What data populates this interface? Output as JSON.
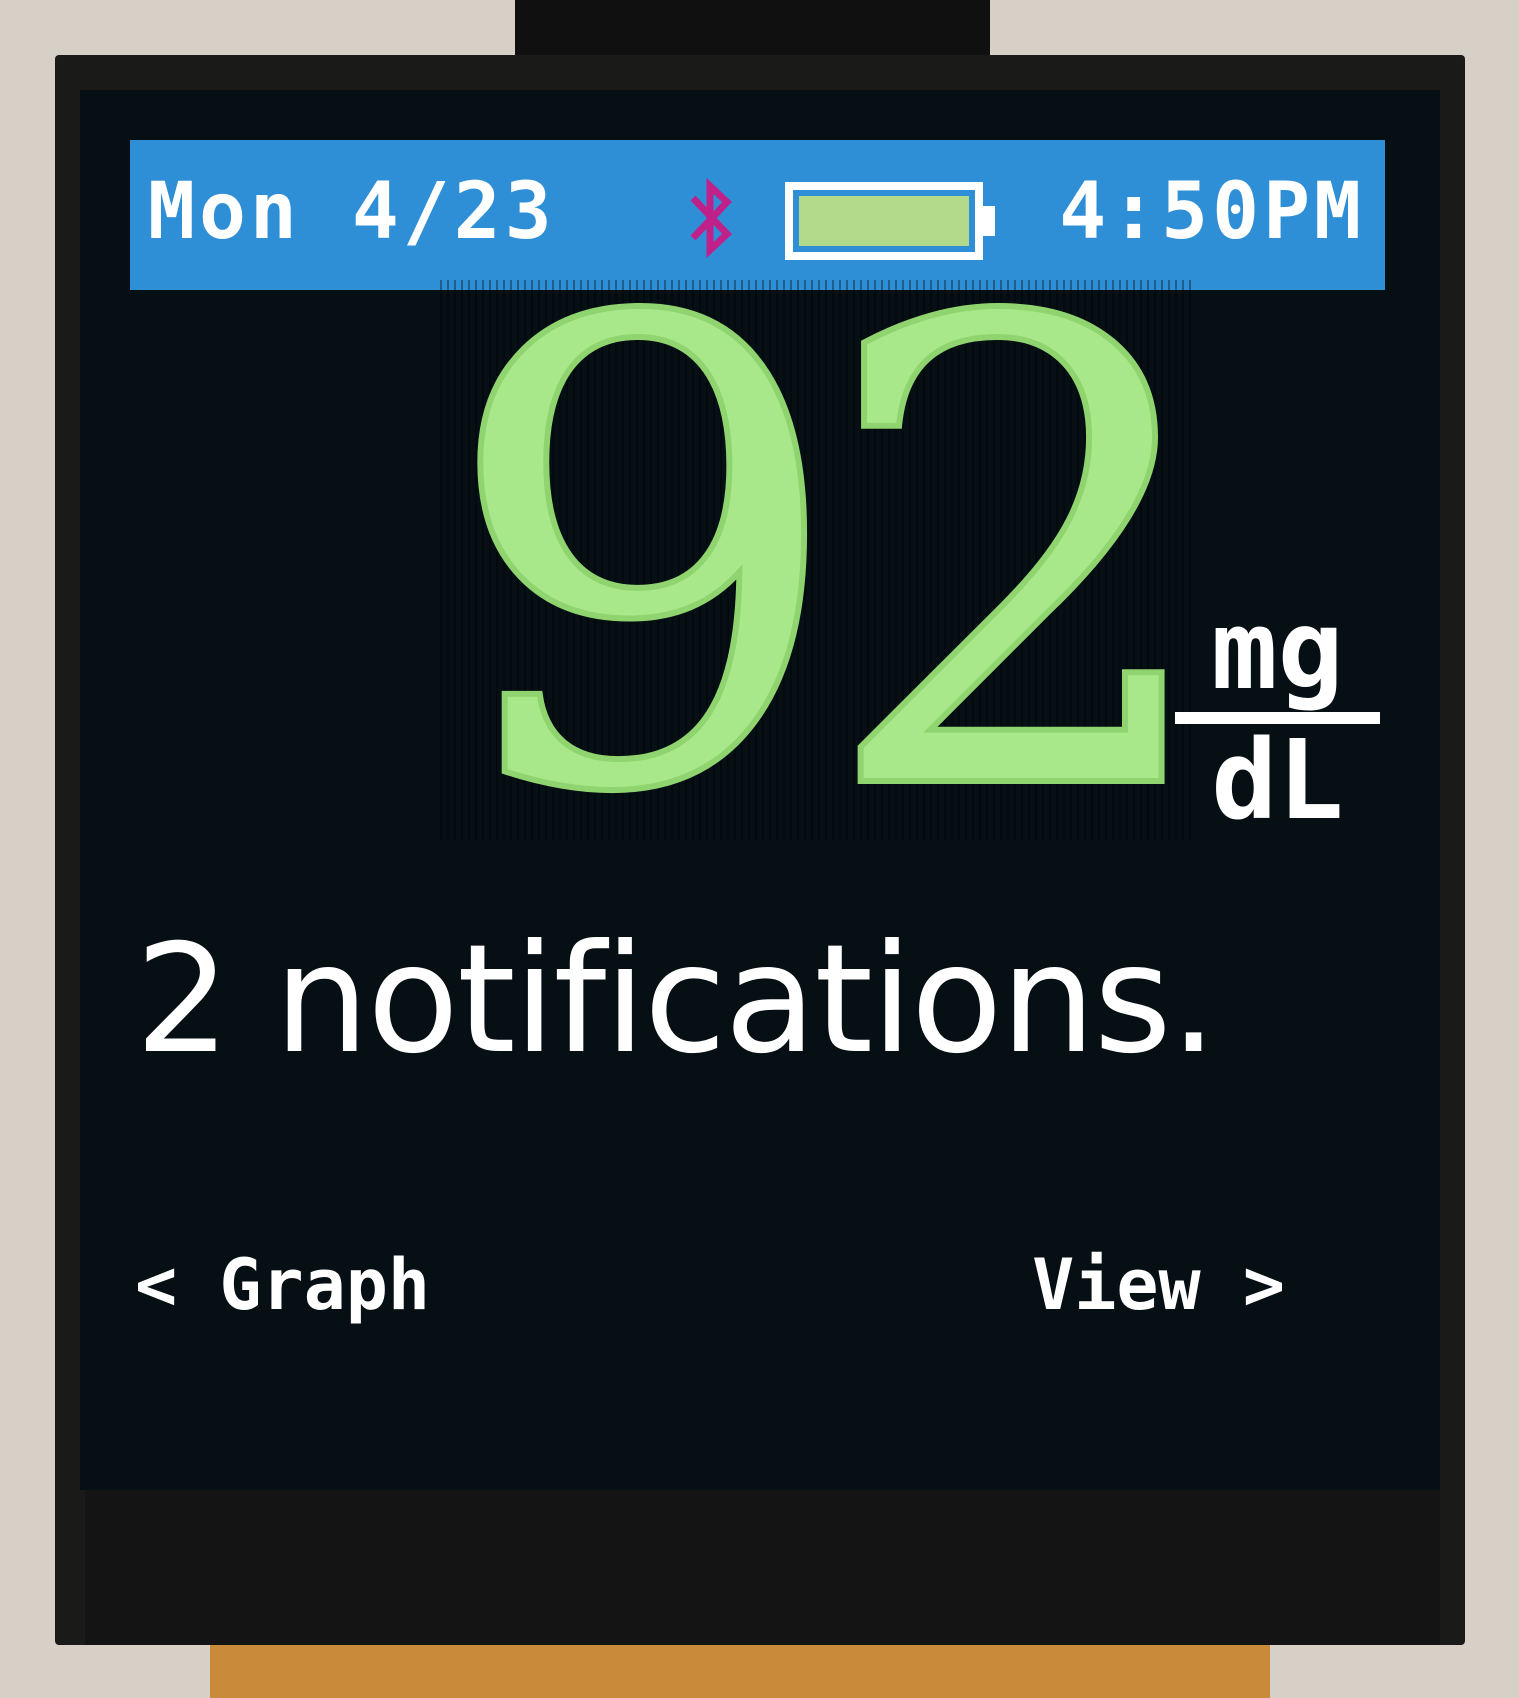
{
  "status_bar": {
    "date": "Mon 4/23",
    "time": "4:50PM",
    "bluetooth_icon": "bluetooth-icon",
    "battery_icon": "battery-icon",
    "battery_level": 1.0,
    "bar_color": "#2f8fd6",
    "bluetooth_color": "#c0208a",
    "battery_fill_color": "#b3d98a"
  },
  "glucose": {
    "value": "92",
    "unit_top": "mg",
    "unit_bottom": "dL",
    "value_color": "#a9e88a"
  },
  "notifications": {
    "text": "2 notifications."
  },
  "nav": {
    "left_arrow": "<",
    "left_label": "Graph",
    "right_label": "View",
    "right_arrow": ">"
  }
}
